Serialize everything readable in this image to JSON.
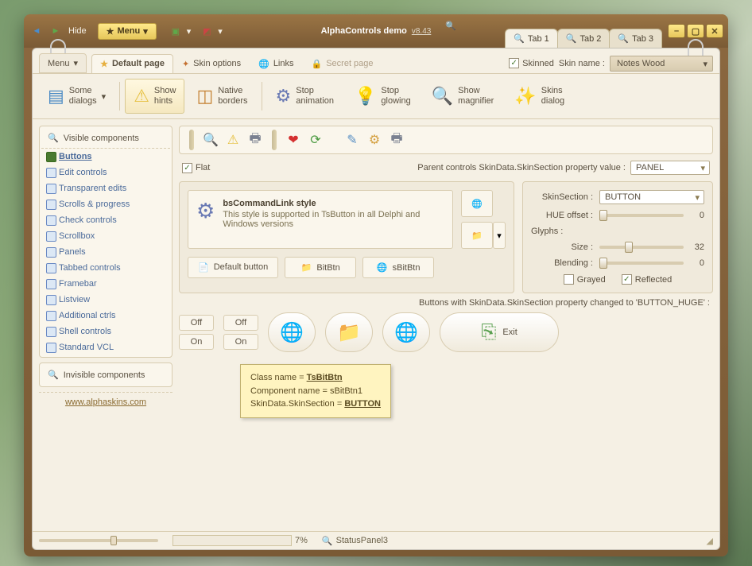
{
  "titlebar": {
    "hide": "Hide",
    "menu": "Menu",
    "title": "AlphaControls demo",
    "version": "v8.43",
    "tabs": [
      "Tab 1",
      "Tab 2",
      "Tab 3"
    ]
  },
  "page_tabs": {
    "menu": "Menu",
    "items": [
      {
        "label": "Default page",
        "icon": "star"
      },
      {
        "label": "Skin options",
        "icon": "wand"
      },
      {
        "label": "Links",
        "icon": "globe"
      },
      {
        "label": "Secret page",
        "icon": "lock"
      }
    ],
    "skinned": "Skinned",
    "skin_name_label": "Skin name :",
    "skin_name_value": "Notes Wood"
  },
  "ribbon": [
    {
      "label": "Some\ndialogs",
      "icon": "dialog",
      "drop": true
    },
    {
      "label": "Show\nhints",
      "icon": "warn",
      "hot": true
    },
    {
      "label": "Native\nborders",
      "icon": "border"
    },
    {
      "label": "Stop\nanimation",
      "icon": "gears"
    },
    {
      "label": "Stop\nglowing",
      "icon": "bulb"
    },
    {
      "label": "Show\nmagnifier",
      "icon": "mag"
    },
    {
      "label": "Skins\ndialog",
      "icon": "skin"
    }
  ],
  "sidebar": {
    "visible_hdr": "Visible components",
    "items": [
      "Buttons",
      "Edit controls",
      "Transparent edits",
      "Scrolls & progress",
      "Check controls",
      "Scrollbox",
      "Panels",
      "Tabbed controls",
      "Framebar",
      "Listview",
      "Additional ctrls",
      "Shell controls",
      "Standard VCL"
    ],
    "invisible_hdr": "Invisible components",
    "footer": "www.alphaskins.com"
  },
  "toolbar2": [
    "mag",
    "warn",
    "printer",
    "heart",
    "refresh",
    "edit",
    "gear",
    "printer2"
  ],
  "flat_row": {
    "flat": "Flat",
    "parent_label": "Parent controls SkinData.SkinSection property value :",
    "parent_value": "PANEL"
  },
  "cmdlink": {
    "title": "bsCommandLink style",
    "sub": "This style is supported in TsButton in all Delphi and Windows versions"
  },
  "btnrow": [
    "Default button",
    "BitBtn",
    "sBitBtn"
  ],
  "right_panel": {
    "skinsection_label": "SkinSection :",
    "skinsection_value": "BUTTON",
    "hue_label": "HUE offset :",
    "hue_value": "0",
    "glyphs": "Glyphs :",
    "size_label": "Size :",
    "size_value": "32",
    "blend_label": "Blending :",
    "blend_value": "0",
    "grayed": "Grayed",
    "reflected": "Reflected"
  },
  "huge": {
    "label": "Buttons with SkinData.SkinSection property changed to 'BUTTON_HUGE' :",
    "off": "Off",
    "on": "On",
    "exit": "Exit"
  },
  "tooltip": {
    "l1a": "Class name = ",
    "l1b": "TsBitBtn",
    "l2": "Component name = sBitBtn1",
    "l3a": "SkinData.SkinSection = ",
    "l3b": "BUTTON"
  },
  "status": {
    "pct": "7%",
    "panel": "StatusPanel3"
  }
}
